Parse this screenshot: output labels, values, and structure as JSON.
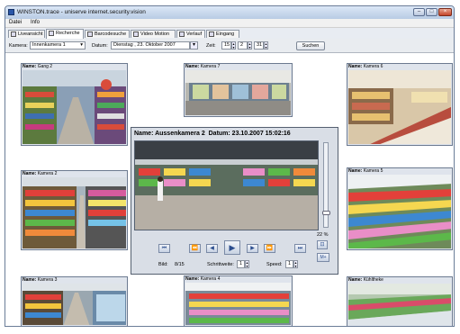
{
  "window": {
    "title": "WINSTON.trace - uniserve internet.security.vision",
    "min": "–",
    "max": "□",
    "close": "×"
  },
  "menu": [
    "Datei",
    "Info"
  ],
  "tabs": [
    "Liveansicht",
    "Recherche",
    "Barcodesuche",
    "Video Motion",
    "Verlauf",
    "Eingang"
  ],
  "toolbar": {
    "kamera_label": "Kamera:",
    "kamera_value": "Innenkamera 1",
    "dropdown_arrow": "▾",
    "datum_label": "Datum:",
    "datum_value": "Dienstag , 23. Oktober  2007",
    "zeit_label": "Zeit:",
    "hour": "15",
    "minute": "2",
    "second": "31",
    "suchen": "Suchen"
  },
  "cams": [
    {
      "prefix": "Name:",
      "name": "Gang 2"
    },
    {
      "prefix": "Name:",
      "name": "Kamera 7"
    },
    {
      "prefix": "Name:",
      "name": "Kamera 6"
    },
    {
      "prefix": "Name:",
      "name": "Kamera 2"
    },
    {
      "prefix": "Name:",
      "name": "Kamera 5"
    },
    {
      "prefix": "Name:",
      "name": "Kamera 3"
    },
    {
      "prefix": "Name:",
      "name": "Kamera 4"
    },
    {
      "prefix": "Name:",
      "name": "Kühltheke"
    }
  ],
  "player": {
    "name_label": "Name: Aussenkamera 2",
    "datum_label": "Datum: 23.10.2007 15:02:16",
    "zoom": "22 %",
    "zoom_btn": "M+",
    "bild_label": "Bild:",
    "bild_value": "8/15",
    "schritt_label": "Schrittweite:",
    "schritt_value": "1",
    "speed_label": "Speed:",
    "speed_value": "1",
    "slider_level": 0.85,
    "controls": [
      "⏮",
      "⏪",
      "◀",
      "▶",
      "▶",
      "⏩",
      "⏭"
    ]
  },
  "colors": {
    "titlebar": "#c9d6e6",
    "accent": "#2b4d8e",
    "close": "#c4452a"
  }
}
